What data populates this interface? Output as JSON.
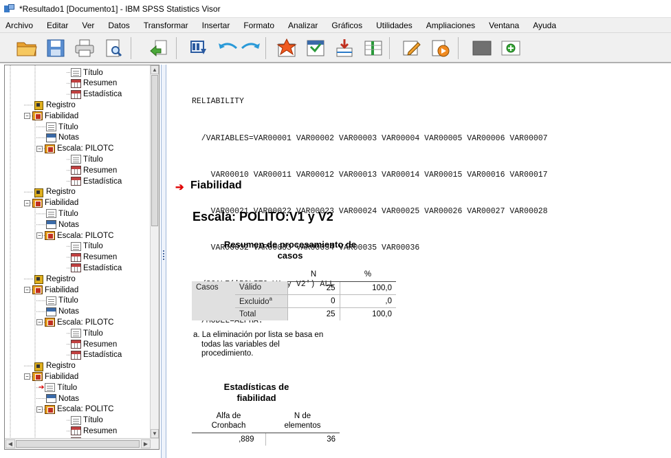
{
  "window": {
    "title": "*Resultado1 [Documento1] - IBM SPSS Statistics Visor"
  },
  "menu": [
    "Archivo",
    "Editar",
    "Ver",
    "Datos",
    "Transformar",
    "Insertar",
    "Formato",
    "Analizar",
    "Gráficos",
    "Utilidades",
    "Ampliaciones",
    "Ventana",
    "Ayuda"
  ],
  "toolbar": {
    "buttons": [
      "folder-open-icon",
      "save-icon",
      "print-icon",
      "print-preview-icon",
      "export-icon",
      "dialog-recall-icon",
      "undo-icon",
      "redo-icon",
      "goto-case-icon",
      "goto-variable-icon",
      "insert-cases-icon",
      "insert-variables-icon",
      "create-edit-icon",
      "script-icon",
      "hide-icon",
      "show-icon"
    ]
  },
  "outline": {
    "items": [
      {
        "label": "Título",
        "icon": "title-icon",
        "depth": 3
      },
      {
        "label": "Resumen",
        "icon": "table-icon",
        "depth": 3
      },
      {
        "label": "Estadística",
        "icon": "table-icon",
        "depth": 3
      },
      {
        "label": "Registro",
        "icon": "log-icon",
        "depth": 1
      },
      {
        "label": "Fiabilidad",
        "icon": "book-icon",
        "depth": 1,
        "expander": "−"
      },
      {
        "label": "Título",
        "icon": "title-icon",
        "depth": 2
      },
      {
        "label": "Notas",
        "icon": "notes-icon",
        "depth": 2
      },
      {
        "label": "Escala: PILOTC",
        "icon": "book-icon",
        "depth": 2,
        "expander": "−"
      },
      {
        "label": "Título",
        "icon": "title-icon",
        "depth": 3
      },
      {
        "label": "Resumen",
        "icon": "table-icon",
        "depth": 3
      },
      {
        "label": "Estadística",
        "icon": "table-icon",
        "depth": 3
      },
      {
        "label": "Registro",
        "icon": "log-icon",
        "depth": 1
      },
      {
        "label": "Fiabilidad",
        "icon": "book-icon",
        "depth": 1,
        "expander": "−"
      },
      {
        "label": "Título",
        "icon": "title-icon",
        "depth": 2
      },
      {
        "label": "Notas",
        "icon": "notes-icon",
        "depth": 2
      },
      {
        "label": "Escala: PILOTC",
        "icon": "book-icon",
        "depth": 2,
        "expander": "−"
      },
      {
        "label": "Título",
        "icon": "title-icon",
        "depth": 3
      },
      {
        "label": "Resumen",
        "icon": "table-icon",
        "depth": 3
      },
      {
        "label": "Estadística",
        "icon": "table-icon",
        "depth": 3
      },
      {
        "label": "Registro",
        "icon": "log-icon",
        "depth": 1
      },
      {
        "label": "Fiabilidad",
        "icon": "book-icon",
        "depth": 1,
        "expander": "−"
      },
      {
        "label": "Título",
        "icon": "title-icon",
        "depth": 2
      },
      {
        "label": "Notas",
        "icon": "notes-icon",
        "depth": 2
      },
      {
        "label": "Escala: PILOTC",
        "icon": "book-icon",
        "depth": 2,
        "expander": "−"
      },
      {
        "label": "Título",
        "icon": "title-icon",
        "depth": 3
      },
      {
        "label": "Resumen",
        "icon": "table-icon",
        "depth": 3
      },
      {
        "label": "Estadística",
        "icon": "table-icon",
        "depth": 3
      },
      {
        "label": "Registro",
        "icon": "log-icon",
        "depth": 1
      },
      {
        "label": "Fiabilidad",
        "icon": "book-icon",
        "depth": 1,
        "expander": "−"
      },
      {
        "label": "Título",
        "icon": "title-icon",
        "depth": 2,
        "current": true
      },
      {
        "label": "Notas",
        "icon": "notes-icon",
        "depth": 2
      },
      {
        "label": "Escala: POLITC",
        "icon": "book-icon",
        "depth": 2,
        "expander": "−"
      },
      {
        "label": "Título",
        "icon": "title-icon",
        "depth": 3
      },
      {
        "label": "Resumen",
        "icon": "table-icon",
        "depth": 3
      },
      {
        "label": "Estadística",
        "icon": "table-icon",
        "depth": 3
      }
    ]
  },
  "syntax": {
    "lines": [
      "RELIABILITY",
      "  /VARIABLES=VAR00001 VAR00002 VAR00003 VAR00004 VAR00005 VAR00006 VAR00007",
      "    VAR00010 VAR00011 VAR00012 VAR00013 VAR00014 VAR00015 VAR00016 VAR00017",
      "    VAR00021 VAR00022 VAR00023 VAR00024 VAR00025 VAR00026 VAR00027 VAR00028",
      "    VAR00032 VAR00033 VAR00034 VAR00035 VAR00036",
      "  /SCALE('POLITO:V1 y V2') ALL",
      "  /MODEL=ALPHA."
    ]
  },
  "heading": "Fiabilidad",
  "scale_heading": "Escala: POLITO:V1 y V2",
  "summary_table": {
    "title_line1": "Resumen de procesamiento de",
    "title_line2": "casos",
    "col_n": "N",
    "col_pct": "%",
    "group": "Casos",
    "rows": [
      {
        "label": "Válido",
        "sup": "",
        "n": "25",
        "pct": "100,0"
      },
      {
        "label": "Excluido",
        "sup": "a",
        "n": "0",
        "pct": ",0"
      },
      {
        "label": "Total",
        "sup": "",
        "n": "25",
        "pct": "100,0"
      }
    ],
    "footnote_line1": "a. La eliminación por lista se basa en",
    "footnote_line2": "todas las variables del",
    "footnote_line3": "procedimiento."
  },
  "reliability_table": {
    "title_line1": "Estadísticas de",
    "title_line2": "fiabilidad",
    "col1_line1": "Alfa de",
    "col1_line2": "Cronbach",
    "col2_line1": "N de",
    "col2_line2": "elementos",
    "alpha": ",889",
    "n_items": "36"
  },
  "colors": {
    "accent": "#e00000",
    "header_gray": "#e0e0e0"
  }
}
